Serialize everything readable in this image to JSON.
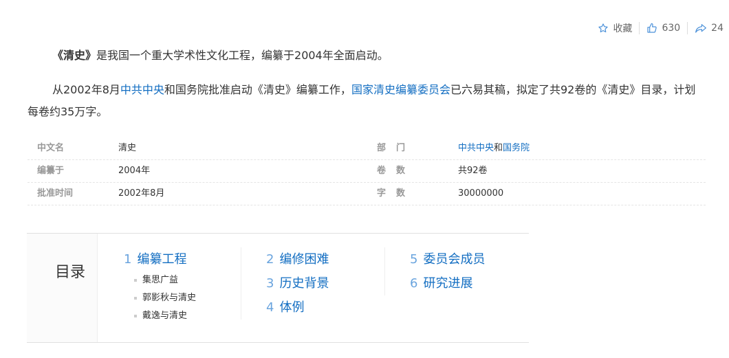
{
  "actions": {
    "favorite_label": "收藏",
    "like_count": "630",
    "share_count": "24"
  },
  "paragraph1": {
    "title": "《清史》",
    "rest": "是我国一个重大学术性文化工程，编纂于2004年全面启动。"
  },
  "paragraph2": {
    "t1": "从2002年8月",
    "link1": "中共中央",
    "t2": "和国务院批准启动《清史》编纂工作，",
    "link2": "国家清史编纂委员会",
    "t3": "已六易其稿，拟定了共92卷的《清史》目录，计划每卷约35万字。"
  },
  "info": {
    "rows": [
      {
        "k1": "中文名",
        "v1": "清史",
        "k2": "部　门",
        "v2_link1": "中共中央",
        "v2_text": "和",
        "v2_link2": "国务院"
      },
      {
        "k1": "编纂于",
        "v1": "2004年",
        "k2": "卷　数",
        "v2": "共92卷"
      },
      {
        "k1": "批准时间",
        "v1": "2002年8月",
        "k2": "字　数",
        "v2": "30000000"
      }
    ]
  },
  "catalog": {
    "title": "目录",
    "sections": [
      {
        "num": "1",
        "label": "编纂工程",
        "children": [
          "集思广益",
          "郭影秋与清史",
          "戴逸与清史"
        ]
      },
      {
        "num": "2",
        "label": "编修困难"
      },
      {
        "num": "3",
        "label": "历史背景"
      },
      {
        "num": "4",
        "label": "体例"
      },
      {
        "num": "5",
        "label": "委员会成员"
      },
      {
        "num": "6",
        "label": "研究进展"
      }
    ]
  },
  "colors": {
    "link": "#136ec2",
    "catalog_number": "#6aa4de",
    "label_gray": "#999999"
  },
  "icons": {
    "favorite": "star-icon",
    "like": "thumbs-up-icon",
    "share": "share-icon"
  }
}
